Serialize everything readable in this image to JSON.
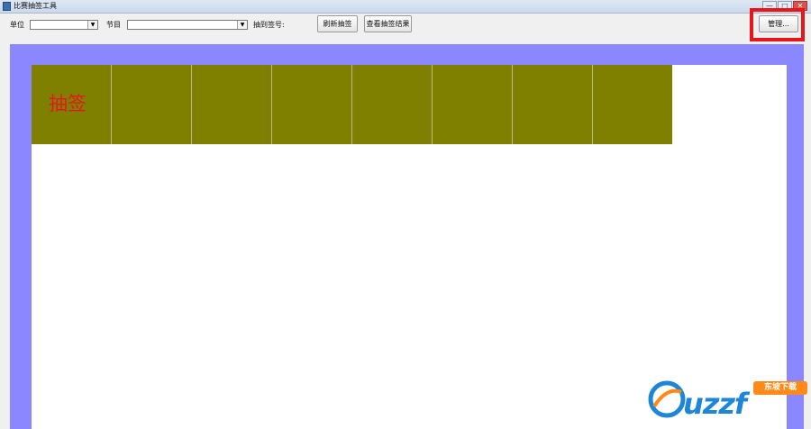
{
  "window": {
    "title": "比赛抽签工具",
    "controls": {
      "minimize": "—",
      "maximize": "□",
      "close": "✕"
    }
  },
  "toolbar": {
    "unit_label": "单位",
    "unit_value": "",
    "program_label": "节目",
    "program_value": "",
    "draw_number_label": "抽到签号:",
    "draw_number_value": "",
    "refresh_button": "刷新抽签",
    "view_results_button": "查看抽签结果",
    "manage_button": "管理..."
  },
  "board": {
    "cells": [
      "抽签",
      "",
      "",
      "",
      "",
      "",
      "",
      ""
    ]
  },
  "colors": {
    "stage_background": "#8a87ff",
    "cell_fill": "#808000",
    "cell_text": "#e8161b",
    "highlight_border": "#e8161b"
  },
  "watermark": {
    "logo_text": "uzzf",
    "badge_text": "东坡下载"
  }
}
